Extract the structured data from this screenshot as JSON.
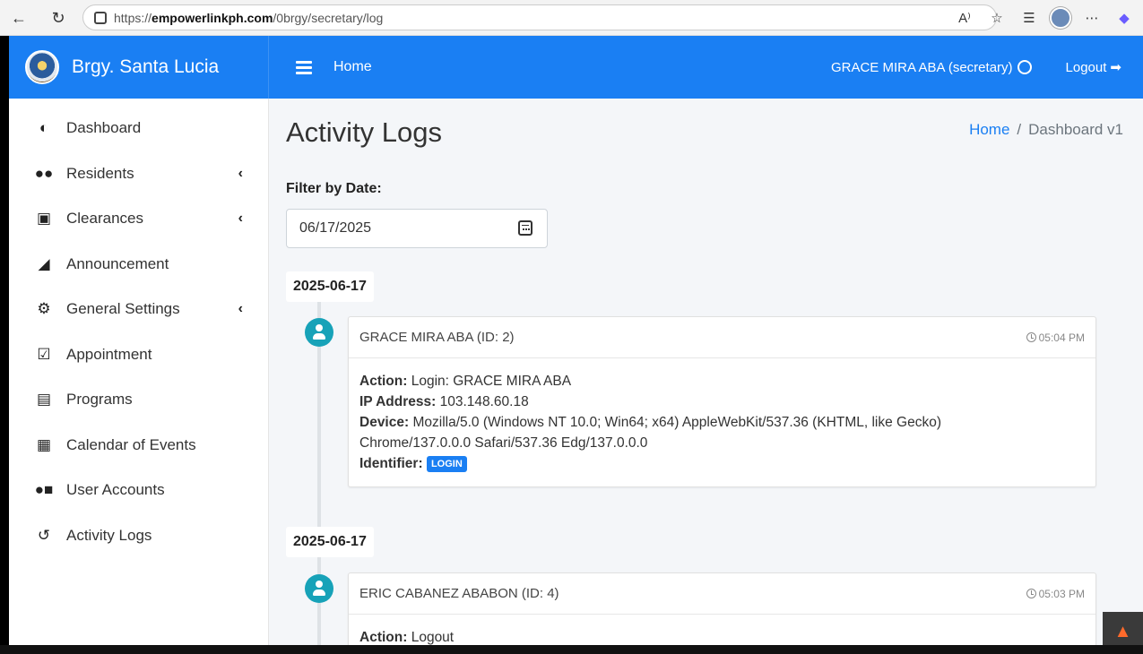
{
  "browser": {
    "url_prefix": "https://",
    "url_domain": "empowerlinkph.com",
    "url_path": "/0brgy/secretary/log"
  },
  "topbar": {
    "brand_name": "Brgy. Santa Lucia",
    "home_label": "Home",
    "user_label": "GRACE MIRA ABA (secretary)",
    "logout_label": "Logout",
    "accent_color": "#1a7ff3"
  },
  "sidebar": {
    "items": [
      {
        "label": "Dashboard",
        "icon": "gauge-icon",
        "has_chevron": false
      },
      {
        "label": "Residents",
        "icon": "users-icon",
        "has_chevron": true
      },
      {
        "label": "Clearances",
        "icon": "word-file-icon",
        "has_chevron": true
      },
      {
        "label": "Announcement",
        "icon": "megaphone-icon",
        "has_chevron": false
      },
      {
        "label": "General Settings",
        "icon": "cog-icon",
        "has_chevron": true
      },
      {
        "label": "Appointment",
        "icon": "calendar-check-icon",
        "has_chevron": false
      },
      {
        "label": "Programs",
        "icon": "file-icon",
        "has_chevron": false
      },
      {
        "label": "Calendar of Events",
        "icon": "calendar-icon",
        "has_chevron": false
      },
      {
        "label": "User Accounts",
        "icon": "user-lock-icon",
        "has_chevron": false
      },
      {
        "label": "Activity Logs",
        "icon": "history-icon",
        "has_chevron": false
      }
    ]
  },
  "main": {
    "page_title": "Activity Logs",
    "breadcrumb_home": "Home",
    "breadcrumb_sep": "/",
    "breadcrumb_current": "Dashboard v1",
    "filter_label": "Filter by Date:",
    "filter_value": "06/17/2025",
    "logs": [
      {
        "date": "2025-06-17",
        "user": "GRACE MIRA ABA (ID: 2)",
        "time": "05:04 PM",
        "action_label": "Action:",
        "action": "Login: GRACE MIRA ABA",
        "ip_label": "IP Address:",
        "ip": "103.148.60.18",
        "device_label": "Device:",
        "device": "Mozilla/5.0 (Windows NT 10.0; Win64; x64) AppleWebKit/537.36 (KHTML, like Gecko) Chrome/137.0.0.0 Safari/537.36 Edg/137.0.0.0",
        "identifier_label": "Identifier:",
        "identifier": "LOGIN"
      },
      {
        "date": "2025-06-17",
        "user": "ERIC CABANEZ ABABON (ID: 4)",
        "time": "05:03 PM",
        "action_label": "Action:",
        "action": "Logout"
      }
    ]
  }
}
